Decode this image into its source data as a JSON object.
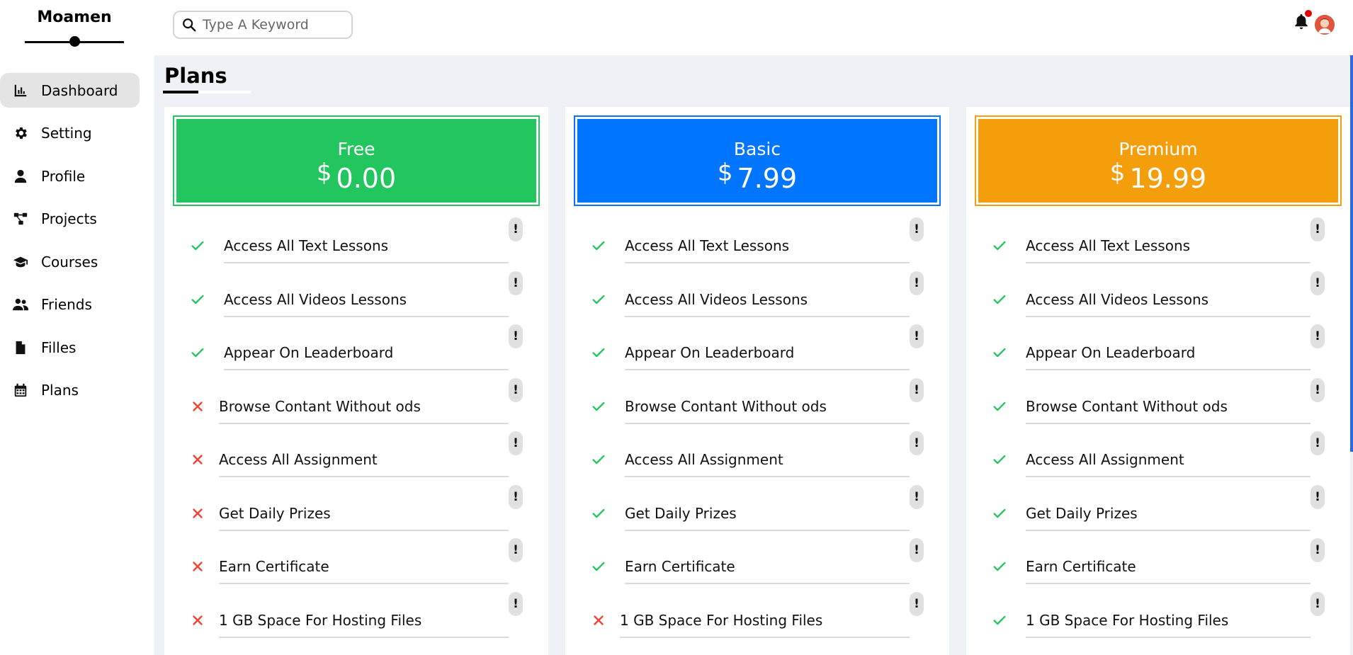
{
  "app": {
    "brand": "Moamen"
  },
  "search": {
    "placeholder": "Type A Keyword"
  },
  "sidebar": {
    "items": [
      {
        "label": "Dashboard",
        "icon": "chart-icon",
        "active": true
      },
      {
        "label": "Setting",
        "icon": "gear-icon",
        "active": false
      },
      {
        "label": "Profile",
        "icon": "user-icon",
        "active": false
      },
      {
        "label": "Projects",
        "icon": "diagram-icon",
        "active": false
      },
      {
        "label": "Courses",
        "icon": "graduation-cap-icon",
        "active": false
      },
      {
        "label": "Friends",
        "icon": "users-icon",
        "active": false
      },
      {
        "label": "Filles",
        "icon": "file-icon",
        "active": false
      },
      {
        "label": "Plans",
        "icon": "calendar-icon",
        "active": false
      }
    ]
  },
  "main": {
    "title": "Plans"
  },
  "colors": {
    "free": "#22c55e",
    "basic": "#0075ff",
    "premium": "#f59e0b",
    "check": "#22c55e",
    "cross": "#f44336"
  },
  "plans": [
    {
      "name": "Free",
      "currency": "$",
      "price": "0.00",
      "color": "#22c55e",
      "features": [
        {
          "text": "Access All Text Lessons",
          "included": true,
          "info": "!"
        },
        {
          "text": "Access All Videos Lessons",
          "included": true,
          "info": "!"
        },
        {
          "text": "Appear On Leaderboard",
          "included": true,
          "info": "!"
        },
        {
          "text": "Browse Contant Without ods",
          "included": false,
          "info": "!"
        },
        {
          "text": "Access All Assignment",
          "included": false,
          "info": "!"
        },
        {
          "text": "Get Daily Prizes",
          "included": false,
          "info": "!"
        },
        {
          "text": "Earn Certificate",
          "included": false,
          "info": "!"
        },
        {
          "text": "1 GB Space For Hosting Files",
          "included": false,
          "info": "!"
        }
      ]
    },
    {
      "name": "Basic",
      "currency": "$",
      "price": "7.99",
      "color": "#0075ff",
      "features": [
        {
          "text": "Access All Text Lessons",
          "included": true,
          "info": "!"
        },
        {
          "text": "Access All Videos Lessons",
          "included": true,
          "info": "!"
        },
        {
          "text": "Appear On Leaderboard",
          "included": true,
          "info": "!"
        },
        {
          "text": "Browse Contant Without ods",
          "included": true,
          "info": "!"
        },
        {
          "text": "Access All Assignment",
          "included": true,
          "info": "!"
        },
        {
          "text": "Get Daily Prizes",
          "included": true,
          "info": "!"
        },
        {
          "text": "Earn Certificate",
          "included": true,
          "info": "!"
        },
        {
          "text": "1 GB Space For Hosting Files",
          "included": false,
          "info": "!"
        }
      ]
    },
    {
      "name": "Premium",
      "currency": "$",
      "price": "19.99",
      "color": "#f59e0b",
      "features": [
        {
          "text": "Access All Text Lessons",
          "included": true,
          "info": "!"
        },
        {
          "text": "Access All Videos Lessons",
          "included": true,
          "info": "!"
        },
        {
          "text": "Appear On Leaderboard",
          "included": true,
          "info": "!"
        },
        {
          "text": "Browse Contant Without ods",
          "included": true,
          "info": "!"
        },
        {
          "text": "Access All Assignment",
          "included": true,
          "info": "!"
        },
        {
          "text": "Get Daily Prizes",
          "included": true,
          "info": "!"
        },
        {
          "text": "Earn Certificate",
          "included": true,
          "info": "!"
        },
        {
          "text": "1 GB Space For Hosting Files",
          "included": true,
          "info": "!"
        }
      ]
    }
  ]
}
